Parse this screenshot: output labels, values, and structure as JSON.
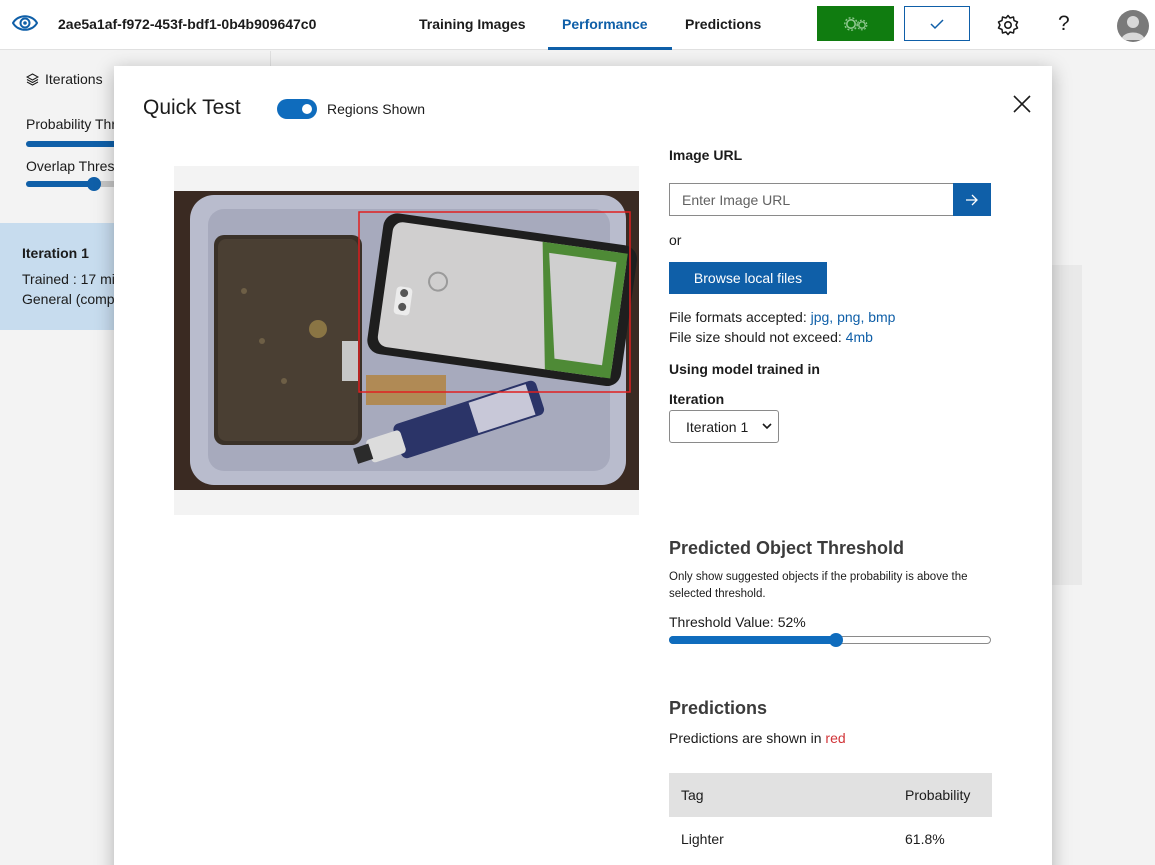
{
  "topbar": {
    "logo_icon": "eye-icon",
    "project_id": "2ae5a1af-f972-453f-bdf1-0b4b909647c0",
    "tabs": [
      {
        "label": "Training Images"
      },
      {
        "label": "Performance",
        "active": true
      },
      {
        "label": "Predictions"
      }
    ],
    "train_button_icon": "gears-icon",
    "quick_test_button_icon": "checkmark-icon",
    "settings_icon": "gear-icon",
    "help_label": "?",
    "avatar_icon": "person-icon",
    "train_color": "#107c10",
    "accent_color": "#0f5fa8"
  },
  "left_panel": {
    "iterations_label": "Iterations",
    "probability_label": "Probability Thr",
    "overlap_label": "Overlap Thresh",
    "iteration_card": {
      "title": "Iteration 1",
      "trained": "Trained : 17 mi",
      "domain": "General (compa"
    }
  },
  "modal": {
    "title": "Quick Test",
    "regions_toggle": {
      "label": "Regions Shown",
      "on": true
    },
    "close_icon": "close-icon",
    "image_url_label": "Image URL",
    "url_placeholder": "Enter Image URL",
    "submit_icon": "arrow-right-icon",
    "or_text": "or",
    "browse_label": "Browse local files",
    "file_formats_prefix": "File formats accepted: ",
    "file_formats": "jpg, png, bmp",
    "file_size_prefix": "File size should not exceed: ",
    "file_size": "4mb",
    "model_label": "Using model trained in",
    "iteration_label": "Iteration",
    "iteration_selected": "Iteration 1",
    "threshold_section": {
      "title": "Predicted Object Threshold",
      "description": "Only show suggested objects if the probability is above the selected threshold.",
      "value_label": "Threshold Value: 52%",
      "value": 0.52
    },
    "predictions_section": {
      "title": "Predictions",
      "shown_prefix": "Predictions are shown in ",
      "shown_color_word": "red",
      "columns": {
        "tag": "Tag",
        "probability": "Probability"
      },
      "rows": [
        {
          "tag": "Lighter",
          "probability": "61.8%"
        }
      ]
    },
    "prediction_box_color": "#e02020"
  }
}
